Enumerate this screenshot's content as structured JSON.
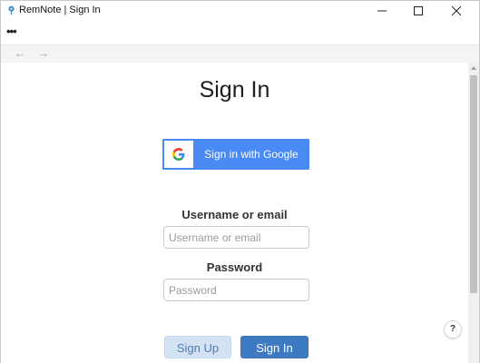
{
  "window": {
    "title": "RemNote | Sign In"
  },
  "menu": {
    "more_label": "•••"
  },
  "nav": {
    "back_glyph": "←",
    "forward_glyph": "→"
  },
  "signin": {
    "title": "Sign In",
    "google_button_label": "Sign in with Google",
    "username_label": "Username or email",
    "username_placeholder": "Username or email",
    "username_value": "",
    "password_label": "Password",
    "password_placeholder": "Password",
    "password_value": "",
    "signup_button_label": "Sign Up",
    "signin_button_label": "Sign In"
  },
  "help": {
    "label": "?"
  },
  "icons": {
    "app": "remnote-logo-icon",
    "google": "google-g-icon",
    "minimize": "minimize-icon",
    "maximize": "maximize-icon",
    "close": "close-icon",
    "back": "arrow-left-icon",
    "forward": "arrow-right-icon",
    "scroll_up": "scroll-up-icon"
  },
  "colors": {
    "google_blue": "#4a8af4",
    "primary_button": "#3d7ac2",
    "secondary_button": "#d3e3f3",
    "secondary_text": "#4d7bb0"
  }
}
